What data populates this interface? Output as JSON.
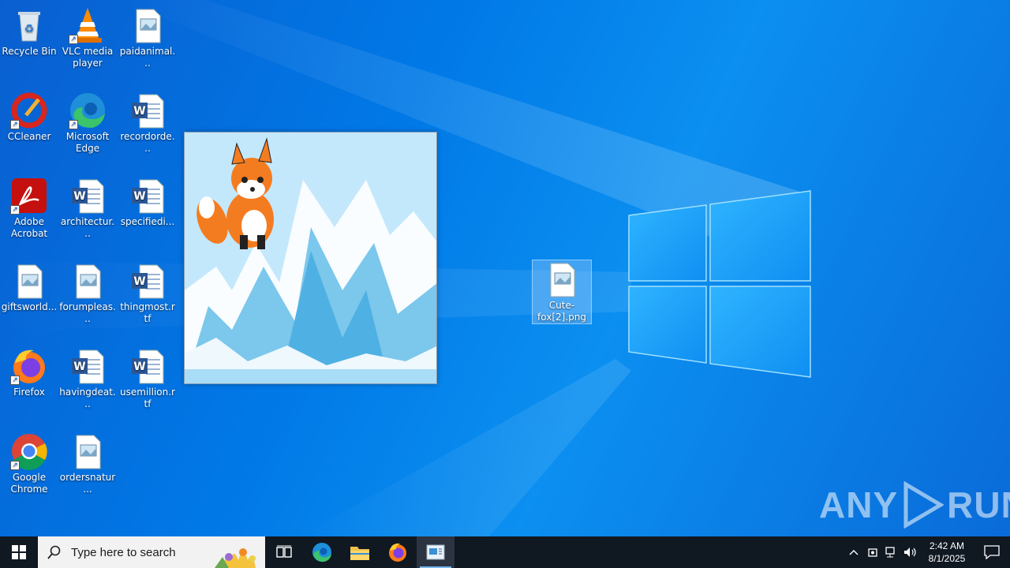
{
  "desktop": {
    "icons": [
      {
        "label": "Recycle Bin",
        "icon": "recycle-bin-icon"
      },
      {
        "label": "VLC media player",
        "icon": "vlc-icon"
      },
      {
        "label": "paidanimal...",
        "icon": "image-file-icon"
      },
      {
        "label": "CCleaner",
        "icon": "ccleaner-icon"
      },
      {
        "label": "Microsoft Edge",
        "icon": "edge-icon"
      },
      {
        "label": "recordorde...",
        "icon": "word-doc-icon"
      },
      {
        "label": "Adobe Acrobat",
        "icon": "acrobat-icon"
      },
      {
        "label": "architectur...",
        "icon": "word-doc-icon"
      },
      {
        "label": "specifiedi...",
        "icon": "word-doc-icon"
      },
      {
        "label": "giftsworld...",
        "icon": "image-file-icon"
      },
      {
        "label": "forumpleas...",
        "icon": "image-file-icon"
      },
      {
        "label": "thingmost.rtf",
        "icon": "word-doc-icon"
      },
      {
        "label": "Firefox",
        "icon": "firefox-icon"
      },
      {
        "label": "havingdeat...",
        "icon": "word-doc-icon"
      },
      {
        "label": "usemillion.rtf",
        "icon": "word-doc-icon"
      },
      {
        "label": "Google Chrome",
        "icon": "chrome-icon"
      },
      {
        "label": "ordersnatur...",
        "icon": "image-file-icon"
      },
      {
        "label": "Cute-fox[2].png",
        "icon": "image-file-icon"
      }
    ]
  },
  "preview": {
    "icon": "fox-image-preview"
  },
  "taskbar": {
    "search_placeholder": "Type here to search",
    "clock_time": "2:42 AM",
    "clock_date": "8/1/2025"
  },
  "watermark": {
    "text": "ANY",
    "text2": "RUN"
  },
  "colors": {
    "taskbar": "#101822",
    "accent": "#76b9ed",
    "wallpaper": "#0078e6"
  }
}
